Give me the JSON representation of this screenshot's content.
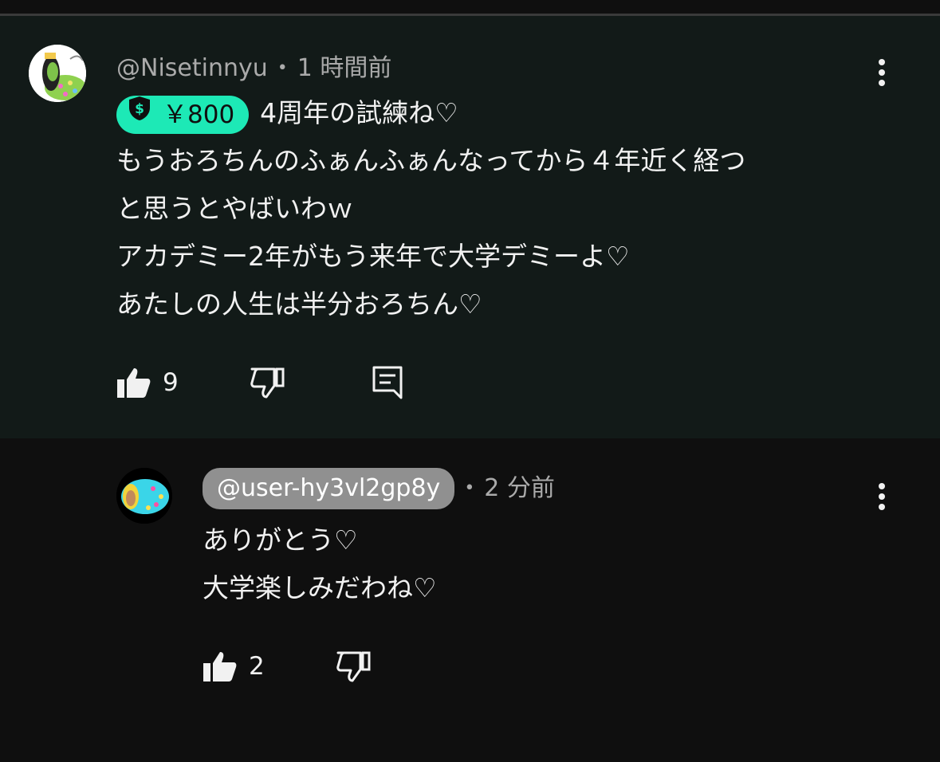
{
  "comment": {
    "handle": "@Nisetinnyu",
    "time": "1 時間前",
    "superchat_amount": "￥800",
    "lines": [
      "4周年の試練ね♡",
      "もうおろちんのふぁんふぁんなってから４年近く経つ",
      "と思うとやばいわｗ",
      "アカデミー2年がもう来年で大学デミーよ♡",
      "あたしの人生は半分おろちん♡"
    ],
    "likes": "9"
  },
  "reply": {
    "handle": "@user-hy3vl2gp8y",
    "time": "2 分前",
    "lines": [
      "ありがとう♡",
      "大学楽しみだわね♡"
    ],
    "likes": "2"
  },
  "colors": {
    "superchat": "#1de9b6",
    "comment_bg": "#121a18",
    "page_bg": "#0f0f0f",
    "handle_pill": "#909090"
  },
  "icons": [
    "avatar",
    "dollar-shield-icon",
    "kebab-menu-icon",
    "thumbs-up-icon",
    "thumbs-down-icon",
    "reply-icon"
  ]
}
